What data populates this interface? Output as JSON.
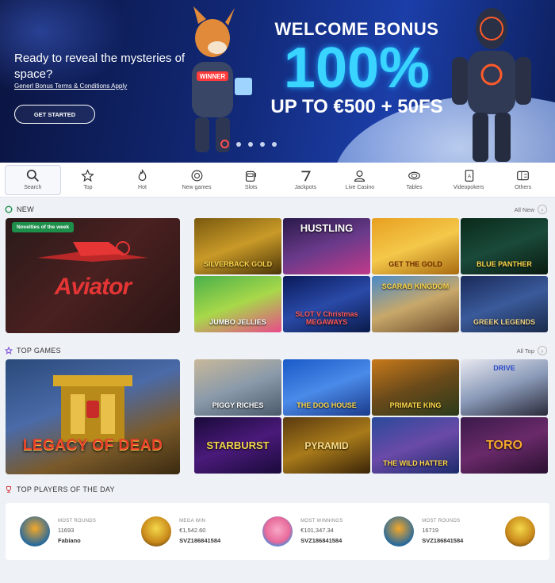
{
  "hero": {
    "headline": "Ready to reveal the mysteries of space?",
    "terms_link": "Generl Bonus Terms & Conditions Apply",
    "cta_label": "GET STARTED",
    "bonus_title": "WELCOME BONUS",
    "bonus_percent": "100%",
    "bonus_upto": "UP TO €500 + 50FS",
    "mascot_badge": "WINNER",
    "slides_count": 5,
    "active_slide": 1
  },
  "categories": [
    {
      "label": "Search",
      "icon": "search-icon"
    },
    {
      "label": "Top",
      "icon": "star-icon"
    },
    {
      "label": "Hot",
      "icon": "flame-icon"
    },
    {
      "label": "New games",
      "icon": "new-badge-icon"
    },
    {
      "label": "Slots",
      "icon": "slot-machine-icon"
    },
    {
      "label": "Jackpots",
      "icon": "seven-icon"
    },
    {
      "label": "Live Casino",
      "icon": "dealer-icon"
    },
    {
      "label": "Tables",
      "icon": "table-icon"
    },
    {
      "label": "Videopokers",
      "icon": "card-icon"
    },
    {
      "label": "Others",
      "icon": "more-games-icon"
    }
  ],
  "new_section": {
    "title": "NEW",
    "all_link": "All New",
    "feature": {
      "badge": "Novelties of the week",
      "name": "Aviator"
    },
    "games": [
      "SILVERBACK GOLD",
      "HUSTLING",
      "GET THE GOLD",
      "BLUE PANTHER",
      "JUMBO JELLIES",
      "SLOT V Christmas MEGAWAYS",
      "SCARAB KINGDOM",
      "GREEK LEGENDS"
    ]
  },
  "top_section": {
    "title": "TOP GAMES",
    "all_link": "All Top",
    "feature": {
      "name": "LEGACY OF DEAD"
    },
    "games": [
      "PIGGY RICHES",
      "THE DOG HOUSE",
      "PRIMATE KING",
      "DRIVE",
      "STARBURST",
      "PYRAMID",
      "THE WILD HATTER",
      "TORO"
    ]
  },
  "players_section": {
    "title": "TOP PLAYERS OF THE DAY",
    "players": [
      {
        "label": "MOST ROUNDS",
        "value": "11693",
        "name": "Fabiano"
      },
      {
        "label": "MEGA WIN",
        "value": "€1,542.60",
        "name": "SVZ186841584"
      },
      {
        "label": "MOST WINNINGS",
        "value": "€101,347.34",
        "name": "SVZ186841584"
      },
      {
        "label": "MOST ROUNDS",
        "value": "16719",
        "name": "SVZ186841584"
      }
    ]
  },
  "colors": {
    "accent_red": "#ff4d4d",
    "bonus_cyan": "#39d4ff",
    "badge_green": "#1e8f4a"
  }
}
